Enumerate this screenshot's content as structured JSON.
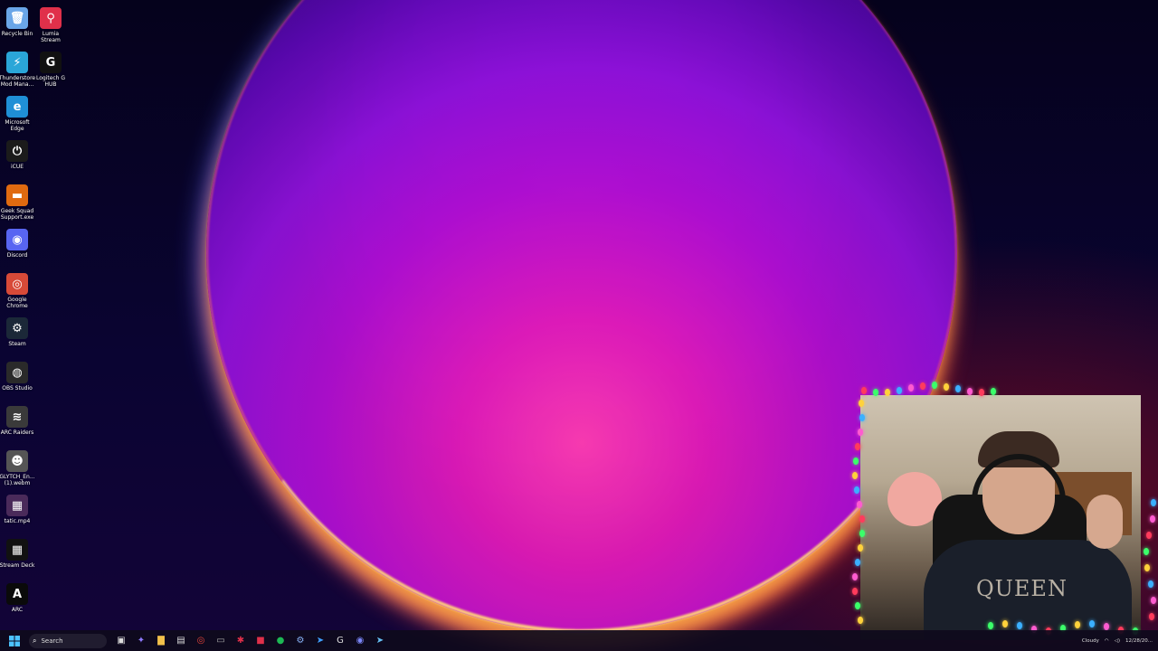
{
  "desktop_icons": [
    {
      "name": "recycle-bin",
      "label": "Recycle Bin",
      "glyph": "🗑",
      "color": "#6aa6e8"
    },
    {
      "name": "lumia-stream",
      "label": "Lumia\nStream",
      "glyph": "⚲",
      "color": "#e0304a"
    },
    {
      "name": "thunderstore",
      "label": "Thunderstore\nMod Mana...",
      "glyph": "⚡",
      "color": "#2aa6d8"
    },
    {
      "name": "logitech-g-hub",
      "label": "Logitech G\nHUB",
      "glyph": "G",
      "color": "#111111"
    },
    {
      "name": "microsoft-edge",
      "label": "Microsoft\nEdge",
      "glyph": "e",
      "color": "#1f8fd6"
    },
    {
      "name": "icue",
      "label": "iCUE",
      "glyph": "⏻",
      "color": "#1b1b1b"
    },
    {
      "name": "geek-squad",
      "label": "Geek Squad\nSupport.exe",
      "glyph": "▬",
      "color": "#e06a10"
    },
    {
      "name": "discord",
      "label": "Discord",
      "glyph": "◉",
      "color": "#5865f2"
    },
    {
      "name": "google-chrome",
      "label": "Google\nChrome",
      "glyph": "◎",
      "color": "#d84a38"
    },
    {
      "name": "steam",
      "label": "Steam",
      "glyph": "⚙",
      "color": "#1b2838"
    },
    {
      "name": "obs-studio",
      "label": "OBS Studio",
      "glyph": "◍",
      "color": "#2a2a2a"
    },
    {
      "name": "arc-raiders",
      "label": "ARC Raiders",
      "glyph": "≋",
      "color": "#3a3a3a"
    },
    {
      "name": "glytch-webm",
      "label": "GLYTCH_En...\n(1).webm",
      "glyph": "☻",
      "color": "#555555"
    },
    {
      "name": "static-mp4",
      "label": "tatic.mp4",
      "glyph": "▦",
      "color": "#4a2a5a"
    },
    {
      "name": "stream-deck",
      "label": "Stream Deck",
      "glyph": "▦",
      "color": "#111111"
    },
    {
      "name": "arc",
      "label": "ARC",
      "glyph": "A",
      "color": "#0a0a0a"
    }
  ],
  "taskbar": {
    "search_placeholder": "Search",
    "apps": [
      {
        "name": "task-view",
        "glyph": "▣"
      },
      {
        "name": "copilot",
        "glyph": "✦"
      },
      {
        "name": "file-explorer",
        "glyph": "▇"
      },
      {
        "name": "store",
        "glyph": "▤"
      },
      {
        "name": "chrome",
        "glyph": "◎"
      },
      {
        "name": "app-generic",
        "glyph": "▭"
      },
      {
        "name": "app-red",
        "glyph": "✱"
      },
      {
        "name": "app-red-square",
        "glyph": "■"
      },
      {
        "name": "spotify",
        "glyph": "●"
      },
      {
        "name": "steam",
        "glyph": "⚙"
      },
      {
        "name": "app-blue",
        "glyph": "➤"
      },
      {
        "name": "logitech",
        "glyph": "G"
      },
      {
        "name": "discord",
        "glyph": "◉"
      },
      {
        "name": "app-steam2",
        "glyph": "➤"
      }
    ],
    "tray": {
      "weather": "Cloudy",
      "date": "12/28/20..."
    }
  },
  "webcam": {
    "shirt_text": "QUEEN"
  }
}
